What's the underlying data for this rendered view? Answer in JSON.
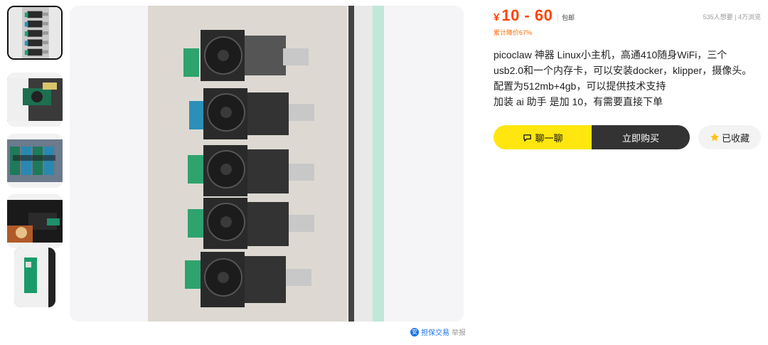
{
  "price": {
    "currency": "¥",
    "range": "10 - 60",
    "shipping": "包邮",
    "stats": "535人想要 | 4万浏览",
    "discount": "累计降价67%"
  },
  "description": {
    "lines": [
      "picoclaw 神器 Linux小主机，高通410随身WiFi，三个",
      "usb2.0和一个内存卡，可以安装docker，klipper，摄像头。",
      "配置为512mb+4gb，可以提供技术支持",
      "加装 ai 助手 是加 10，有需要直接下单"
    ]
  },
  "actions": {
    "chat": "聊一聊",
    "buy": "立即购买",
    "favorite": "已收藏"
  },
  "footer": {
    "guarantee": "担保交易",
    "guarantee_icon": "安",
    "report": "举报"
  },
  "colors": {
    "price": "#ff4401",
    "chat_btn": "#ffe60f",
    "buy_btn": "#333333"
  },
  "icons": {
    "chat": "chat-bubble-icon",
    "favorite": "star-icon",
    "guarantee": "shield-icon"
  }
}
